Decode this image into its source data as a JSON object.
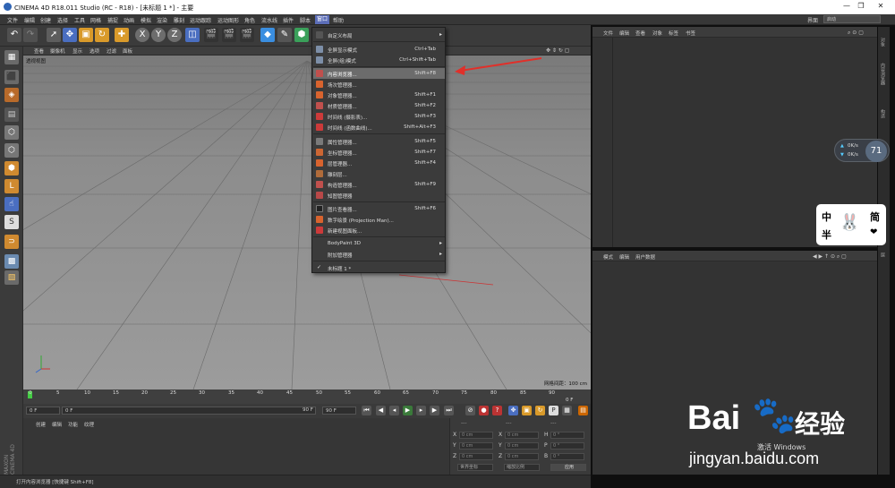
{
  "titlebar": {
    "title": "CINEMA 4D R18.011 Studio (RC - R18) - [未标题 1 *] - 主要"
  },
  "menubar": {
    "items": [
      "文件",
      "编辑",
      "创建",
      "选择",
      "工具",
      "网格",
      "捕捉",
      "动画",
      "模拟",
      "渲染",
      "雕刻",
      "运动跟踪",
      "运动图形",
      "角色",
      "流水线",
      "插件",
      "脚本",
      "窗口",
      "帮助"
    ],
    "layout_label": "界面",
    "layout_value": "启动"
  },
  "viewport": {
    "menu": [
      "查看",
      "摄像机",
      "显示",
      "选项",
      "过滤",
      "面板"
    ],
    "label": "透视视图",
    "grid_label": "网格间距：100 cm"
  },
  "timeline": {
    "ticks": [
      "0",
      "5",
      "10",
      "15",
      "20",
      "25",
      "30",
      "35",
      "40",
      "45",
      "50",
      "55",
      "60",
      "65",
      "70",
      "75",
      "80",
      "85",
      "90"
    ],
    "end_label": "0 F"
  },
  "transport": {
    "start": "0 F",
    "current": "0 F",
    "end": "90 F",
    "end2": "90 F"
  },
  "material_panel": {
    "menu": [
      "创建",
      "编辑",
      "功能",
      "纹理"
    ]
  },
  "coord_panel": {
    "headers": [
      "---",
      "---",
      "---"
    ],
    "rows": [
      {
        "a": "X",
        "av": "0 cm",
        "b": "X",
        "bv": "0 cm",
        "c": "H",
        "cv": "0 °"
      },
      {
        "a": "Y",
        "av": "0 cm",
        "b": "Y",
        "bv": "0 cm",
        "c": "P",
        "cv": "0 °"
      },
      {
        "a": "Z",
        "av": "0 cm",
        "b": "Z",
        "bv": "0 cm",
        "c": "B",
        "cv": "0 °"
      }
    ],
    "mode1": "世界坐标",
    "mode2": "缩放比例",
    "apply": "应用"
  },
  "statusbar": {
    "text": "打开内容浏览器 [快捷键 Shift+F8]"
  },
  "object_panel": {
    "menu": [
      "文件",
      "编辑",
      "查看",
      "对象",
      "标签",
      "书签"
    ]
  },
  "attr_panel": {
    "menu": [
      "模式",
      "编辑",
      "用户数据"
    ]
  },
  "sidetabs": [
    "对象",
    "内容浏览器",
    "构造",
    "层"
  ],
  "netwidget": {
    "up": "0K/s",
    "down": "0K/s",
    "percent": "71"
  },
  "sticker": {
    "chars": [
      "中",
      "简",
      "半"
    ]
  },
  "dropdown": {
    "items": [
      {
        "label": "自定义布局",
        "shortcut": "",
        "arrow": "▸",
        "icon": "layout-icon",
        "color": "#3b3b3b"
      },
      {
        "label": "全屏显示模式",
        "shortcut": "Ctrl+Tab",
        "icon": "fullscreen-icon",
        "color": "#7d8fa8"
      },
      {
        "label": "全屏(组)模式",
        "shortcut": "Ctrl+Shift+Tab",
        "icon": "fullscreen-group-icon",
        "color": "#7d8fa8"
      },
      {
        "label": "内容浏览器...",
        "shortcut": "Shift+F8",
        "icon": "content-browser-icon",
        "color": "#c0504d"
      },
      {
        "label": "场次管理器...",
        "shortcut": "",
        "icon": "take-manager-icon",
        "color": "#d8632e"
      },
      {
        "label": "对象管理器...",
        "shortcut": "Shift+F1",
        "icon": "object-manager-icon",
        "color": "#d8632e"
      },
      {
        "label": "材质管理器...",
        "shortcut": "Shift+F2",
        "icon": "material-manager-icon",
        "color": "#c0504d"
      },
      {
        "label": "时间线 (摄影表)...",
        "shortcut": "Shift+F3",
        "icon": "timeline-dopesheet-icon",
        "color": "#cc3a3a"
      },
      {
        "label": "时间线 (函数曲线)...",
        "shortcut": "Shift+Alt+F3",
        "icon": "timeline-fcurve-icon",
        "color": "#cc3a3a"
      },
      {
        "label": "属性管理器...",
        "shortcut": "Shift+F5",
        "icon": "attribute-manager-icon",
        "color": "#7a7a7a"
      },
      {
        "label": "坐标管理器...",
        "shortcut": "Shift+F7",
        "icon": "coordinate-manager-icon",
        "color": "#cc6633"
      },
      {
        "label": "层管理器...",
        "shortcut": "Shift+F4",
        "icon": "layer-manager-icon",
        "color": "#d8632e"
      },
      {
        "label": "雕刻层...",
        "shortcut": "",
        "icon": "sculpt-layer-icon",
        "color": "#b06b3a"
      },
      {
        "label": "构造管理器...",
        "shortcut": "Shift+F9",
        "icon": "structure-manager-icon",
        "color": "#c0504d"
      },
      {
        "label": "知图管理器",
        "shortcut": "",
        "icon": "xpresso-manager-icon",
        "color": "#b84848"
      },
      {
        "label": "图片查看器...",
        "shortcut": "Shift+F6",
        "icon": "picture-viewer-icon",
        "color": "#3b3b3b"
      },
      {
        "label": "数字绘景 (Projection Man)...",
        "shortcut": "",
        "icon": "projection-man-icon",
        "color": "#d8632e"
      },
      {
        "label": "新建视图面板...",
        "shortcut": "",
        "icon": "new-viewport-icon",
        "color": "#cc3a3a"
      },
      {
        "label": "BodyPaint 3D",
        "shortcut": "",
        "arrow": "▸",
        "icon": "",
        "color": "#3b3b3b"
      },
      {
        "label": "附加管理器",
        "shortcut": "",
        "arrow": "▸",
        "icon": "",
        "color": "#3b3b3b"
      },
      {
        "label": "未标题 1 *",
        "shortcut": "",
        "check": "✓",
        "icon": "",
        "color": "#3b3b3b"
      }
    ]
  },
  "watermark": {
    "brand": "Bai",
    "brand2": "经验",
    "url": "jingyan.baidu.com",
    "windows": "激活 Windows"
  },
  "maxon": {
    "label": "MAXON CINEMA 4D"
  }
}
